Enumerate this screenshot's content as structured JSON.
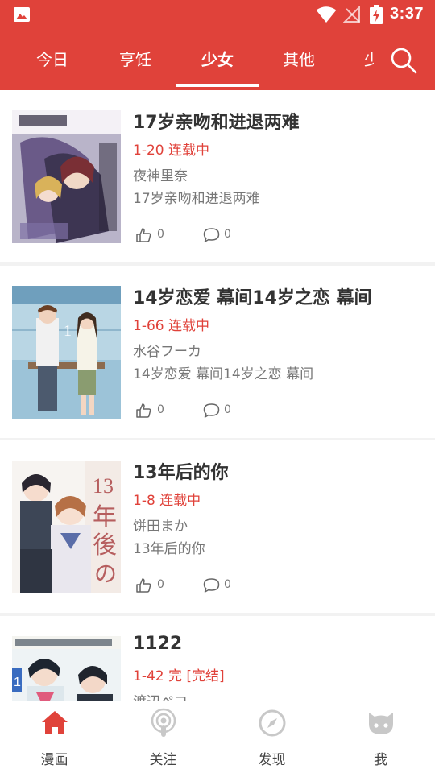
{
  "status_bar": {
    "time": "3:37",
    "icons": [
      "image-icon",
      "wifi-icon",
      "no-signal-icon",
      "battery-charging-icon"
    ]
  },
  "tabs": [
    {
      "label": "今日"
    },
    {
      "label": "亨饪"
    },
    {
      "label": "少女"
    },
    {
      "label": "其他"
    },
    {
      "label": "少"
    }
  ],
  "active_tab": "少女",
  "items": [
    {
      "title": "17岁亲吻和进退两难",
      "chapter": "1-20 连载中",
      "author": "夜神里奈",
      "desc": "17岁亲吻和进退两难",
      "likes": "0",
      "comments": "0"
    },
    {
      "title": "14岁恋爱 幕间14岁之恋 幕间",
      "chapter": "1-66 连载中",
      "author": "水谷フーカ",
      "desc": "14岁恋爱 幕间14岁之恋 幕间",
      "likes": "0",
      "comments": "0"
    },
    {
      "title": "13年后的你",
      "chapter": "1-8 连载中",
      "author": "饼田まか",
      "desc": "13年后的你",
      "likes": "0",
      "comments": "0"
    },
    {
      "title": "1122",
      "chapter": "1-42 完 [完结]",
      "author": "渡辺ペコ",
      "desc": "",
      "likes": "",
      "comments": ""
    }
  ],
  "bottom_nav": [
    {
      "label": "漫画",
      "icon": "home-icon",
      "active": true
    },
    {
      "label": "关注",
      "icon": "podcast-icon",
      "active": false
    },
    {
      "label": "发现",
      "icon": "compass-icon",
      "active": false
    },
    {
      "label": "我",
      "icon": "github-cat-icon",
      "active": false
    }
  ],
  "colors": {
    "accent": "#e0423a",
    "inactive_icon": "#c8c8c8"
  }
}
